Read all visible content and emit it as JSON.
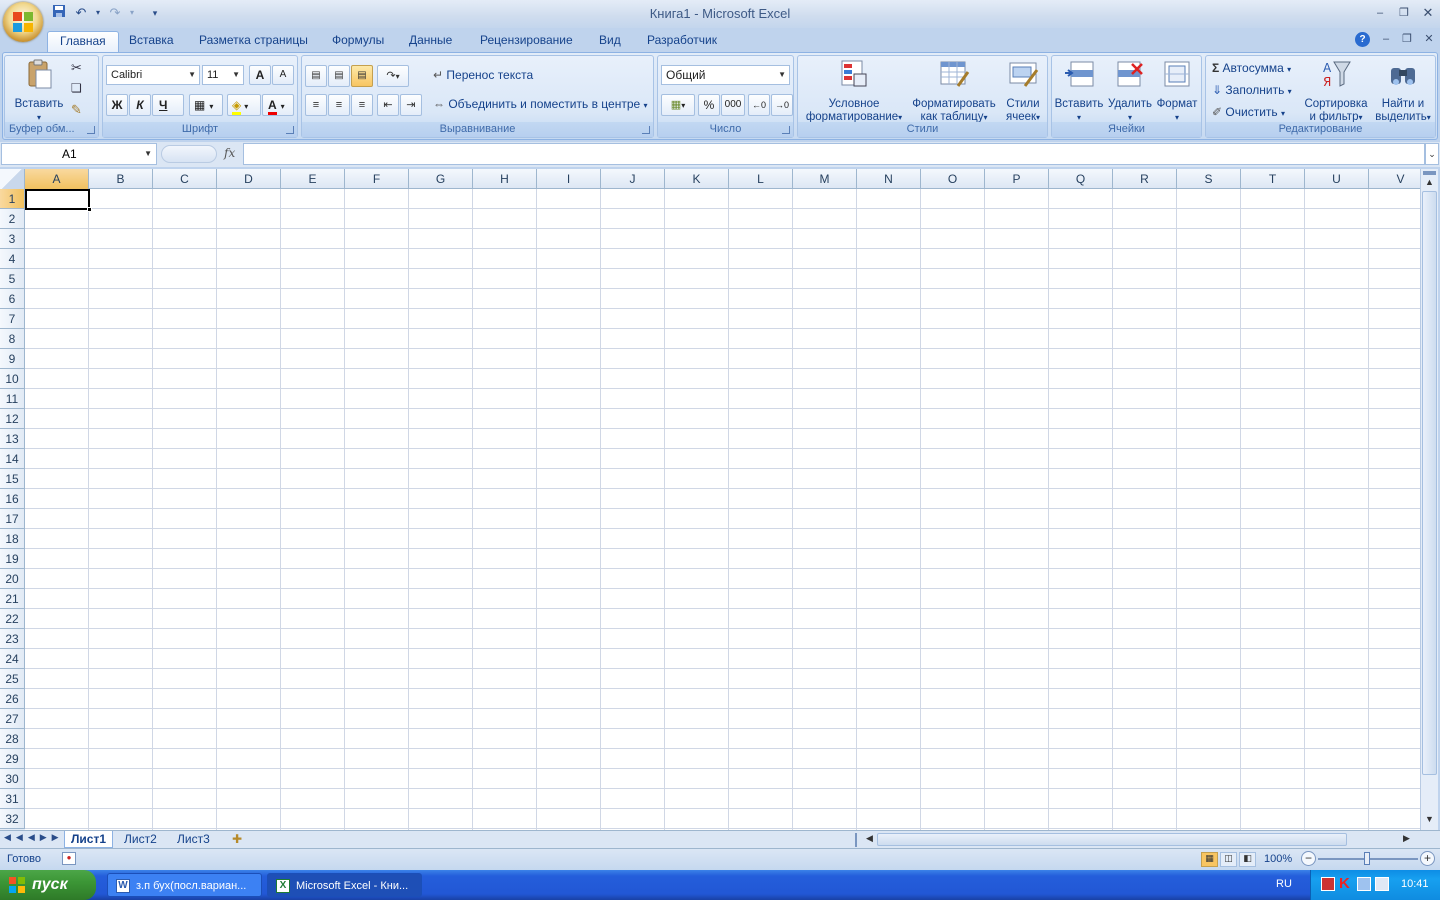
{
  "window": {
    "title": "Книга1 - Microsoft Excel"
  },
  "qat": {
    "save_icon": "save-icon",
    "undo_icon": "undo-icon",
    "redo_icon": "redo-icon"
  },
  "tabs": [
    {
      "label": "Главная"
    },
    {
      "label": "Вставка"
    },
    {
      "label": "Разметка страницы"
    },
    {
      "label": "Формулы"
    },
    {
      "label": "Данные"
    },
    {
      "label": "Рецензирование"
    },
    {
      "label": "Вид"
    },
    {
      "label": "Разработчик"
    }
  ],
  "ribbon": {
    "clipboard": {
      "label": "Буфер обм...",
      "paste": "Вставить"
    },
    "font": {
      "label": "Шрифт",
      "font_name": "Calibri",
      "font_size": "11",
      "bold": "Ж",
      "italic": "К",
      "underline": "Ч",
      "grow": "A",
      "shrink": "A",
      "font_color": "A"
    },
    "alignment": {
      "label": "Выравнивание",
      "wrap": "Перенос текста",
      "merge": "Объединить и поместить в центре"
    },
    "number": {
      "label": "Число",
      "format": "Общий",
      "percent": "%",
      "thousands": "000"
    },
    "styles": {
      "label": "Стили",
      "conditional_line1": "Условное",
      "conditional_line2": "форматирование",
      "format_table_line1": "Форматировать",
      "format_table_line2": "как таблицу",
      "cell_styles_line1": "Стили",
      "cell_styles_line2": "ячеек"
    },
    "cells": {
      "label": "Ячейки",
      "insert": "Вставить",
      "delete": "Удалить",
      "format": "Формат"
    },
    "editing": {
      "label": "Редактирование",
      "autosum": "Автосумма",
      "fill": "Заполнить",
      "clear": "Очистить",
      "sort_line1": "Сортировка",
      "sort_line2": "и фильтр",
      "find_line1": "Найти и",
      "find_line2": "выделить"
    }
  },
  "formula_bar": {
    "name_box": "A1",
    "fx": "fx",
    "value": ""
  },
  "columns": [
    "A",
    "B",
    "C",
    "D",
    "E",
    "F",
    "G",
    "H",
    "I",
    "J",
    "K",
    "L",
    "M",
    "N",
    "O",
    "P",
    "Q",
    "R",
    "S",
    "T",
    "U",
    "V"
  ],
  "rows": [
    "1",
    "2",
    "3",
    "4",
    "5",
    "6",
    "7",
    "8",
    "9",
    "10",
    "11",
    "12",
    "13",
    "14",
    "15",
    "16",
    "17",
    "18",
    "19",
    "20",
    "21",
    "22",
    "23",
    "24",
    "25",
    "26",
    "27",
    "28",
    "29",
    "30",
    "31",
    "32"
  ],
  "sheets": [
    {
      "label": "Лист1",
      "active": true
    },
    {
      "label": "Лист2"
    },
    {
      "label": "Лист3"
    }
  ],
  "status": {
    "ready": "Готово",
    "zoom": "100%"
  },
  "taskbar": {
    "start": "пуск",
    "tasks": [
      {
        "label": "з.п бух(посл.вариан..."
      },
      {
        "label": "Microsoft Excel - Кни..."
      }
    ],
    "lang": "RU",
    "clock": "10:41"
  },
  "colors": {
    "accent": "#15428b",
    "ribbon_bg": "#dbe6f4",
    "grid_line": "#d0d7e5",
    "selected_header": "#f9d99f",
    "taskbar": "#245edb",
    "start": "#3c9636"
  }
}
